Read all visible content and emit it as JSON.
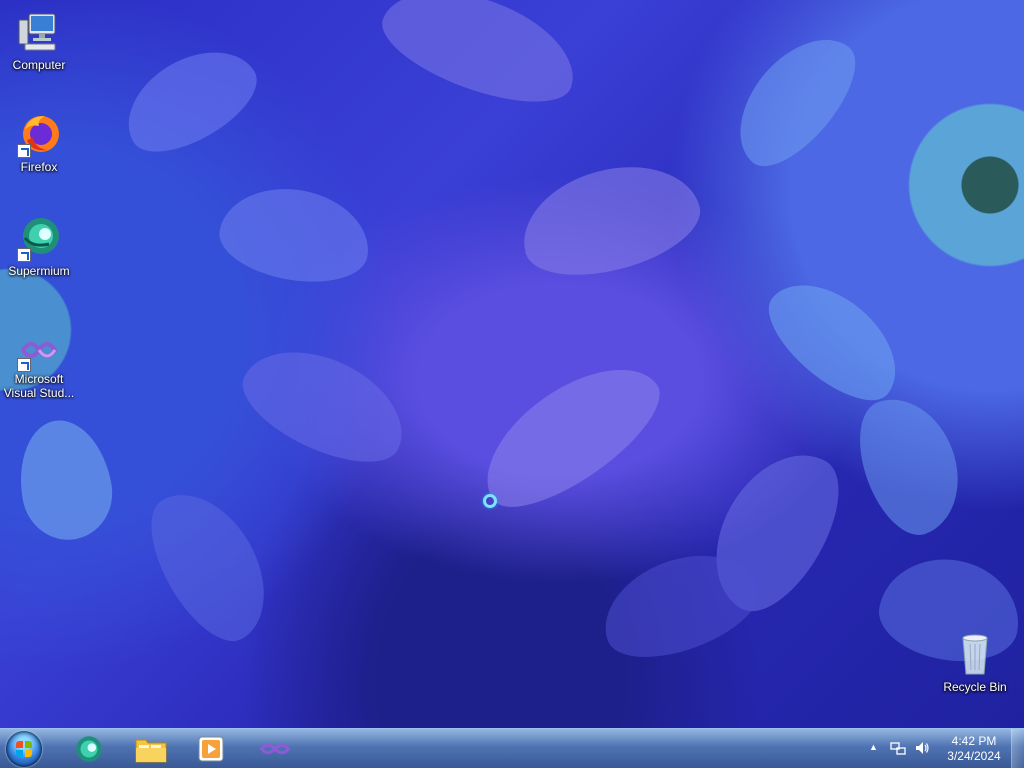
{
  "desktop": {
    "icons": [
      {
        "label": "Computer",
        "icon": "computer-icon"
      },
      {
        "label": "Firefox",
        "icon": "firefox-icon"
      },
      {
        "label": "Supermium",
        "icon": "supermium-icon"
      },
      {
        "label": "Microsoft Visual Stud...",
        "icon": "visual-studio-icon"
      },
      {
        "label": "Recycle Bin",
        "icon": "recycle-bin-icon"
      }
    ]
  },
  "taskbar": {
    "pinned": [
      {
        "name": "supermium",
        "icon": "supermium-icon"
      },
      {
        "name": "explorer",
        "icon": "folder-icon"
      },
      {
        "name": "media-player",
        "icon": "media-player-icon"
      },
      {
        "name": "visual-studio",
        "icon": "visual-studio-icon"
      }
    ],
    "tray": {
      "time": "4:42 PM",
      "date": "3/24/2024"
    }
  },
  "colors": {
    "taskbar_top": "#82aadc",
    "taskbar_bottom": "#284b8c",
    "wallpaper_base": "#2b2ec4"
  }
}
